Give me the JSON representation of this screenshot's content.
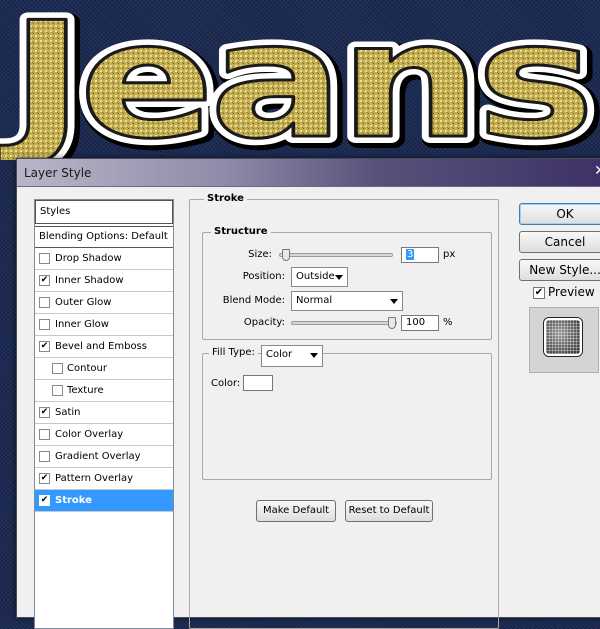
{
  "artwork": {
    "text": "Jeans"
  },
  "dialog": {
    "title": "Layer Style",
    "styles_header": "Styles",
    "blending_options": "Blending Options: Default",
    "effects": [
      {
        "label": "Drop Shadow",
        "checked": false,
        "sub": false,
        "selected": false
      },
      {
        "label": "Inner Shadow",
        "checked": true,
        "sub": false,
        "selected": false
      },
      {
        "label": "Outer Glow",
        "checked": false,
        "sub": false,
        "selected": false
      },
      {
        "label": "Inner Glow",
        "checked": false,
        "sub": false,
        "selected": false
      },
      {
        "label": "Bevel and Emboss",
        "checked": true,
        "sub": false,
        "selected": false
      },
      {
        "label": "Contour",
        "checked": false,
        "sub": true,
        "selected": false
      },
      {
        "label": "Texture",
        "checked": false,
        "sub": true,
        "selected": false
      },
      {
        "label": "Satin",
        "checked": true,
        "sub": false,
        "selected": false
      },
      {
        "label": "Color Overlay",
        "checked": false,
        "sub": false,
        "selected": false
      },
      {
        "label": "Gradient Overlay",
        "checked": false,
        "sub": false,
        "selected": false
      },
      {
        "label": "Pattern Overlay",
        "checked": true,
        "sub": false,
        "selected": false
      },
      {
        "label": "Stroke",
        "checked": true,
        "sub": false,
        "selected": true
      }
    ],
    "stroke": {
      "section_title": "Stroke",
      "structure_title": "Structure",
      "size_label": "Size:",
      "size_value": "3",
      "size_unit": "px",
      "size_slider_level": 0.03,
      "position_label": "Position:",
      "position_value": "Outside",
      "blend_mode_label": "Blend Mode:",
      "blend_mode_value": "Normal",
      "opacity_label": "Opacity:",
      "opacity_value": "100",
      "opacity_unit": "%",
      "opacity_slider_level": 1.0,
      "fill_type_label": "Fill Type:",
      "fill_type_value": "Color",
      "color_label": "Color:",
      "color_value": "#ffffff"
    },
    "buttons": {
      "make_default": "Make Default",
      "reset_to_default": "Reset to Default",
      "ok": "OK",
      "cancel": "Cancel",
      "new_style": "New Style...",
      "preview": "Preview"
    },
    "preview_checked": true
  },
  "colors": {
    "selection": "#3399ff",
    "background": "#1b2a52",
    "artwork_gold": "#c8b35a"
  }
}
